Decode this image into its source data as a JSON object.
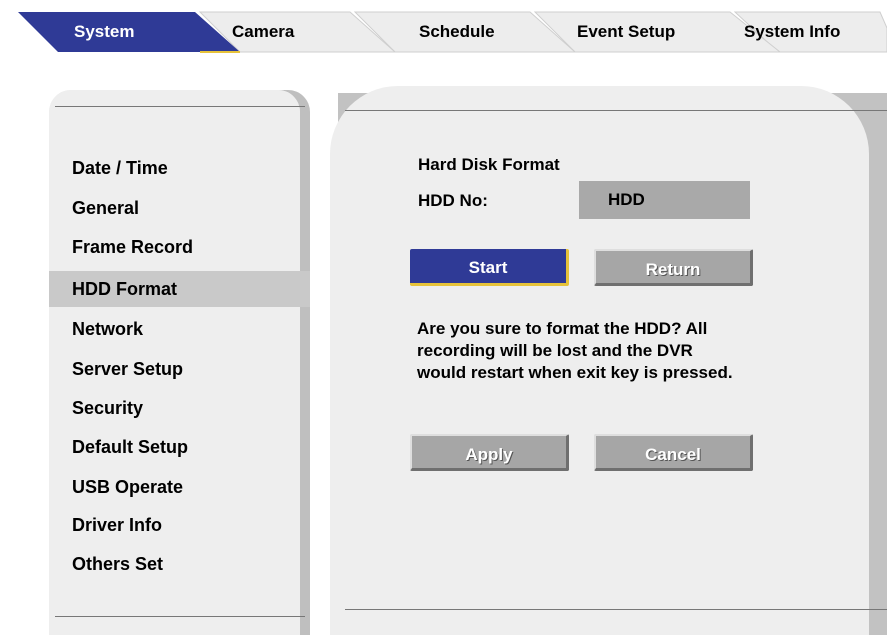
{
  "tabs": [
    {
      "label": "System",
      "active": true
    },
    {
      "label": "Camera",
      "active": false
    },
    {
      "label": "Schedule",
      "active": false
    },
    {
      "label": "Event Setup",
      "active": false
    },
    {
      "label": "System Info",
      "active": false
    }
  ],
  "sidebar": {
    "items": [
      {
        "label": "Date / Time"
      },
      {
        "label": "General"
      },
      {
        "label": "Frame Record"
      },
      {
        "label": "HDD Format",
        "selected": true
      },
      {
        "label": "Network"
      },
      {
        "label": "Server Setup"
      },
      {
        "label": "Security"
      },
      {
        "label": "Default Setup"
      },
      {
        "label": "USB Operate"
      },
      {
        "label": "Driver Info"
      },
      {
        "label": "Others Set"
      }
    ]
  },
  "main": {
    "title": "Hard Disk Format",
    "hdd_label": "HDD No:",
    "hdd_value": "HDD",
    "start_label": "Start",
    "return_label": "Return",
    "message_line1": "Are you sure to format the HDD? All",
    "message_line2": "recording will be lost and the DVR",
    "message_line3": "would restart when exit key is pressed.",
    "apply_label": "Apply",
    "cancel_label": "Cancel"
  },
  "colors": {
    "active_tab": "#2f3a96",
    "inactive_tab": "#ededed",
    "panel_bg": "#eeeeee",
    "selected_item": "#c9c9c9",
    "start_button": "#2f3a96",
    "button_focus_border": "#e6c23a",
    "grey_button": "#a6a6a6"
  }
}
